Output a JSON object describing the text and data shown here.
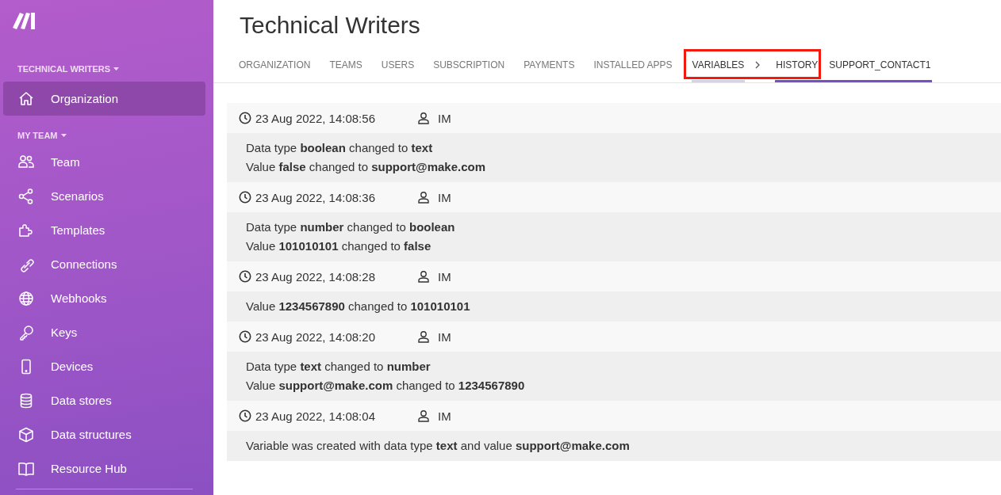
{
  "sidebar": {
    "sections": [
      {
        "label": "TECHNICAL WRITERS",
        "items": [
          {
            "label": "Organization",
            "selected": true
          }
        ]
      },
      {
        "label": "MY TEAM",
        "items": [
          {
            "label": "Team",
            "selected": false
          },
          {
            "label": "Scenarios",
            "selected": false
          },
          {
            "label": "Templates",
            "selected": false
          },
          {
            "label": "Connections",
            "selected": false
          },
          {
            "label": "Webhooks",
            "selected": false
          },
          {
            "label": "Keys",
            "selected": false
          },
          {
            "label": "Devices",
            "selected": false
          },
          {
            "label": "Data stores",
            "selected": false
          },
          {
            "label": "Data structures",
            "selected": false
          },
          {
            "label": "Resource Hub",
            "selected": false
          }
        ]
      }
    ]
  },
  "page": {
    "title": "Technical Writers"
  },
  "tabs": [
    {
      "label": "ORGANIZATION",
      "selected": false
    },
    {
      "label": "TEAMS",
      "selected": false
    },
    {
      "label": "USERS",
      "selected": false
    },
    {
      "label": "SUBSCRIPTION",
      "selected": false
    },
    {
      "label": "PAYMENTS",
      "selected": false
    },
    {
      "label": "INSTALLED APPS",
      "selected": false
    }
  ],
  "breadcrumb": [
    {
      "label": "VARIABLES",
      "selected": false
    },
    {
      "label": "HISTORY",
      "detail": "SUPPORT_CONTACT1",
      "selected": true
    }
  ],
  "history": [
    {
      "time": "23 Aug 2022, 14:08:56",
      "user": "IM",
      "changes": [
        "Data type **boolean** changed to **text**",
        "Value **false** changed to **support@make.com**"
      ]
    },
    {
      "time": "23 Aug 2022, 14:08:36",
      "user": "IM",
      "changes": [
        "Data type **number** changed to **boolean**",
        "Value **101010101** changed to **false**"
      ]
    },
    {
      "time": "23 Aug 2022, 14:08:28",
      "user": "IM",
      "changes": [
        "Value **1234567890** changed to **101010101**"
      ]
    },
    {
      "time": "23 Aug 2022, 14:08:20",
      "user": "IM",
      "changes": [
        "Data type **text** changed to **number**",
        "Value **support@make.com** changed to **1234567890**"
      ]
    },
    {
      "time": "23 Aug 2022, 14:08:04",
      "user": "IM",
      "changes": [
        "Variable was created with data type **text** and value **support@make.com**"
      ]
    }
  ]
}
